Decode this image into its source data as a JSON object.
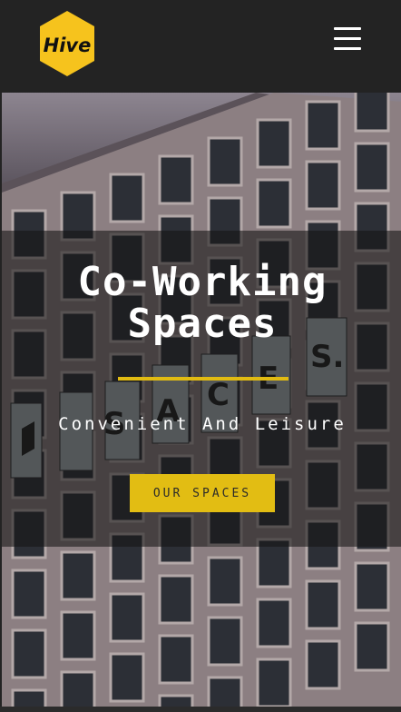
{
  "brand": {
    "logo_text": "Hive",
    "logo_color": "#f6c31d"
  },
  "header": {
    "menu_icon": "hamburger-menu-icon"
  },
  "hero": {
    "title_line1": "Co-Working",
    "title_line2": "Spaces",
    "subtitle": "Convenient And Leisure",
    "cta_label": "OUR SPACES",
    "accent_color": "#e1bb12",
    "building_sign_letters": "SPACES"
  }
}
